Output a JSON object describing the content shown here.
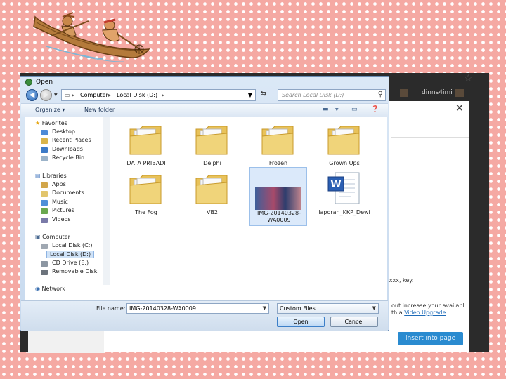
{
  "dialog": {
    "title": "Open",
    "address": {
      "segments": [
        "Computer",
        "Local Disk (D:)"
      ]
    },
    "search_placeholder": "Search Local Disk (D:)",
    "toolbar": {
      "organize": "Organize ▾",
      "new_folder": "New folder"
    },
    "nav": {
      "favorites": "Favorites",
      "favorites_items": [
        "Desktop",
        "Recent Places",
        "Downloads",
        "Recycle Bin"
      ],
      "libraries": "Libraries",
      "libraries_items": [
        "Apps",
        "Documents",
        "Music",
        "Pictures",
        "Videos"
      ],
      "computer": "Computer",
      "computer_items": [
        "Local Disk (C:)",
        "Local Disk (D:)",
        "CD Drive (E:)",
        "Removable Disk"
      ],
      "network": "Network"
    },
    "files": [
      {
        "name": "DATA PRIBADI",
        "type": "folder"
      },
      {
        "name": "Delphi",
        "type": "folder"
      },
      {
        "name": "Frozen",
        "type": "folder"
      },
      {
        "name": "Grown Ups",
        "type": "folder"
      },
      {
        "name": "The Fog",
        "type": "folder"
      },
      {
        "name": "VB2",
        "type": "folder"
      },
      {
        "name": "IMG-20140328-WA0009",
        "type": "image",
        "selected": true
      },
      {
        "name": "laporan_KKP_Dewi",
        "type": "word"
      }
    ],
    "file_name_label": "File name:",
    "file_name_value": "IMG-20140328-WA0009",
    "file_type": "Custom Files",
    "open_button": "Open",
    "cancel_button": "Cancel"
  },
  "background": {
    "user": "dinns4imi",
    "text_key": "xxxx, key.",
    "text_line1": "out increase your availabl",
    "text_line2_prefix": "th a ",
    "text_line2_link": "Video Upgrade",
    "insert_button": "Insert into page"
  },
  "colors": {
    "page_background": "#f5a9a3",
    "accent": "#2a8bd0"
  }
}
